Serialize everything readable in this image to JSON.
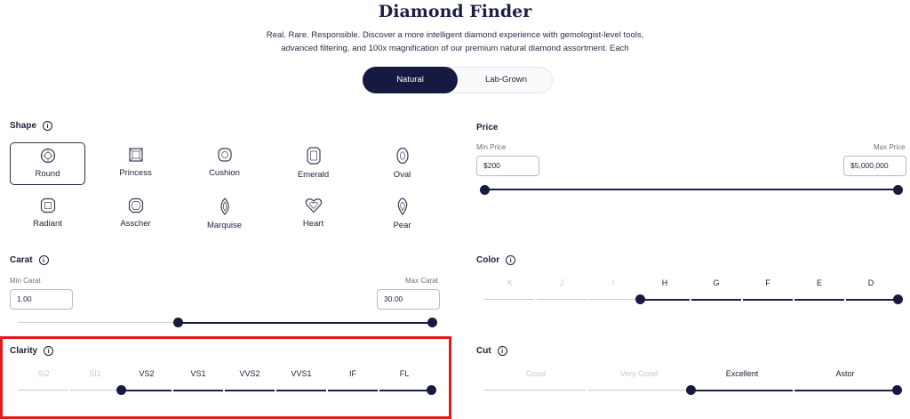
{
  "header": {
    "title": "Diamond Finder",
    "subtitle_line1": "Real. Rare. Responsible. Discover a more intelligent diamond experience with gemologist-level tools,",
    "subtitle_line2": "advanced filtering, and 100x magnification of our premium natural diamond assortment. Each"
  },
  "toggle": {
    "active": "Natural",
    "inactive": "Lab-Grown"
  },
  "shape": {
    "title": "Shape",
    "selected": "Round",
    "items": [
      "Round",
      "Princess",
      "Cushion",
      "Emerald",
      "Oval",
      "Radiant",
      "Asscher",
      "Marquise",
      "Heart",
      "Pear"
    ]
  },
  "price": {
    "title": "Price",
    "min_label": "Min Price",
    "max_label": "Max Price",
    "min_value": "$200",
    "max_value": "$5,000,000"
  },
  "carat": {
    "title": "Carat",
    "min_label": "Min Carat",
    "max_label": "Max Carat",
    "min_value": "1.00",
    "max_value": "30.00"
  },
  "color": {
    "title": "Color",
    "grades": [
      "K",
      "J",
      "I",
      "H",
      "G",
      "F",
      "E",
      "D"
    ],
    "selected_from": "H",
    "selected_to": "D"
  },
  "clarity": {
    "title": "Clarity",
    "grades": [
      "SI2",
      "SI1",
      "VS2",
      "VS1",
      "VVS2",
      "VVS1",
      "IF",
      "FL"
    ],
    "selected_from": "VS2",
    "selected_to": "FL"
  },
  "cut": {
    "title": "Cut",
    "grades": [
      "Good",
      "Very Good",
      "Excellent",
      "Astor"
    ],
    "selected_from": "Excellent",
    "selected_to": "Astor"
  },
  "icons": {
    "info": "i"
  },
  "colors": {
    "navy": "#161a40",
    "highlight": "#e01b1b"
  }
}
